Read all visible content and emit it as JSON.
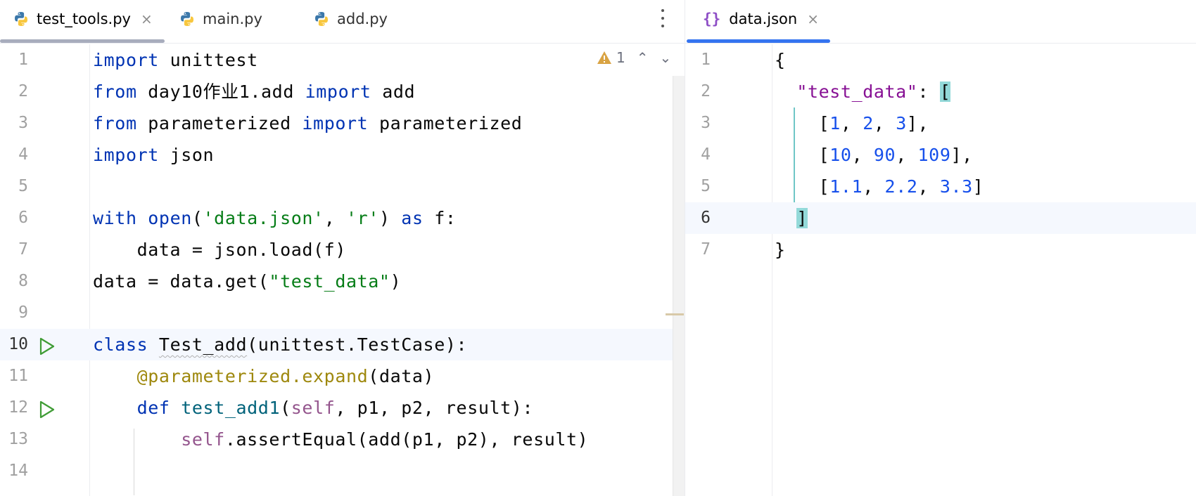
{
  "left_tabs": [
    {
      "label": "test_tools.py",
      "icon": "python-icon",
      "active": true,
      "close": "×"
    },
    {
      "label": "main.py",
      "icon": "python-icon",
      "active": false
    },
    {
      "label": "add.py",
      "icon": "python-icon",
      "active": false
    }
  ],
  "right_tabs": [
    {
      "label": "data.json",
      "icon": "{}",
      "active": true,
      "close": "×"
    }
  ],
  "inspection": {
    "warning_count": "1",
    "warning_icon": "warning-triangle-icon",
    "up": "⌃",
    "down": "⌄"
  },
  "left_editor": {
    "line_numbers": [
      "1",
      "2",
      "3",
      "4",
      "5",
      "6",
      "7",
      "8",
      "9",
      "10",
      "11",
      "12",
      "13",
      "14"
    ],
    "current_line": "10",
    "run_lines": [
      "10",
      "12"
    ]
  },
  "right_editor": {
    "line_numbers": [
      "1",
      "2",
      "3",
      "4",
      "5",
      "6",
      "7"
    ],
    "current_line": "6"
  },
  "code": {
    "l1_kw": "import",
    "l1_rest": " unittest",
    "l2_kw1": "from",
    "l2_mid": " day10作业1.add ",
    "l2_kw2": "import",
    "l2_rest": " add",
    "l3_kw1": "from",
    "l3_mid": " parameterized ",
    "l3_kw2": "import",
    "l3_rest": " parameterized",
    "l4_kw": "import",
    "l4_rest": " json",
    "l6_kw1": "with",
    "l6_a": " ",
    "l6_open": "open",
    "l6_b": "(",
    "l6_s1": "'data.json'",
    "l6_c": ", ",
    "l6_s2": "'r'",
    "l6_d": ") ",
    "l6_kw2": "as",
    "l6_e": " f:",
    "l7": "    data = json.load(f)",
    "l8_a": "data = data.get(",
    "l8_s": "\"test_data\"",
    "l8_b": ")",
    "l10_kw": "class",
    "l10_a": " ",
    "l10_cls": "Test_add",
    "l10_b": "(unittest.TestCase):",
    "l11_ind": "    ",
    "l11_deco": "@parameterized.expand",
    "l11_b": "(data)",
    "l12_ind": "    ",
    "l12_kw": "def",
    "l12_a": " ",
    "l12_fn": "test_add1",
    "l12_b": "(",
    "l12_self": "self",
    "l12_c": ", p1, p2, result):",
    "l13_ind": "        ",
    "l13_self": "self",
    "l13_b": ".assertEqual(add(p1, p2), result)"
  },
  "json_code": {
    "j1": "{",
    "j2_ind": "  ",
    "j2_key": "\"test_data\"",
    "j2_a": ": ",
    "j2_br": "[",
    "j3_ind": "    ",
    "j3_a": "[",
    "j3_n1": "1",
    "j3_b": ", ",
    "j3_n2": "2",
    "j3_c": ", ",
    "j3_n3": "3",
    "j3_d": "],",
    "j4_ind": "    ",
    "j4_a": "[",
    "j4_n1": "10",
    "j4_b": ", ",
    "j4_n2": "90",
    "j4_c": ", ",
    "j4_n3": "109",
    "j4_d": "],",
    "j5_ind": "    ",
    "j5_a": "[",
    "j5_n1": "1.1",
    "j5_b": ", ",
    "j5_n2": "2.2",
    "j5_c": ", ",
    "j5_n3": "3.3",
    "j5_d": "]",
    "j6_ind": "  ",
    "j6_br": "]",
    "j7": "}"
  },
  "colors": {
    "keyword": "#0033b3",
    "string": "#067d17",
    "decorator": "#9e880d",
    "self": "#94558d",
    "function": "#00627a",
    "number": "#1750eb",
    "json_key": "#871094",
    "bracket_highlight": "#93d9d9",
    "run": "#3f9c35",
    "tab_accent": "#3574f0"
  }
}
